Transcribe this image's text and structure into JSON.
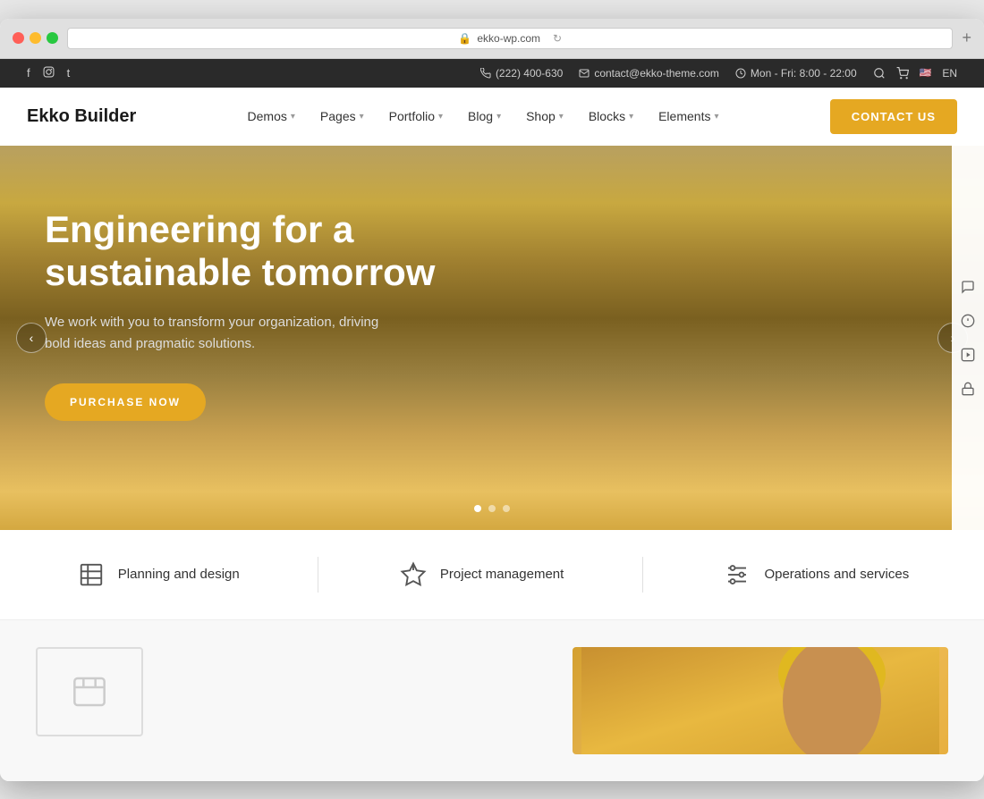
{
  "browser": {
    "url": "ekko-wp.com",
    "new_tab_label": "+"
  },
  "top_bar": {
    "social": {
      "facebook": "f",
      "instagram": "◻",
      "twitter": "t"
    },
    "phone": "(222) 400-630",
    "email": "contact@ekko-theme.com",
    "hours": "Mon - Fri: 8:00 - 22:00",
    "lang": "EN"
  },
  "nav": {
    "logo": "Ekko Builder",
    "items": [
      {
        "label": "Demos",
        "has_dropdown": true
      },
      {
        "label": "Pages",
        "has_dropdown": true
      },
      {
        "label": "Portfolio",
        "has_dropdown": true
      },
      {
        "label": "Blog",
        "has_dropdown": true
      },
      {
        "label": "Shop",
        "has_dropdown": true
      },
      {
        "label": "Blocks",
        "has_dropdown": true
      },
      {
        "label": "Elements",
        "has_dropdown": true
      }
    ],
    "cta": "Contact US"
  },
  "hero": {
    "title": "Engineering for a sustainable tomorrow",
    "subtitle": "We work with you to transform your organization, driving bold ideas and pragmatic solutions.",
    "cta_label": "PURCHASE NOW",
    "arrow_left": "‹",
    "arrow_right": "›",
    "dots": [
      true,
      false,
      false
    ]
  },
  "right_sidebar": {
    "icons": [
      "💬",
      "ℹ",
      "▶",
      "🔒"
    ]
  },
  "services": {
    "items": [
      {
        "icon": "📐",
        "label": "Planning and design"
      },
      {
        "icon": "📊",
        "label": "Project management"
      },
      {
        "icon": "⚙",
        "label": "Operations and services"
      }
    ]
  },
  "bottom": {
    "card_icon": "□"
  }
}
